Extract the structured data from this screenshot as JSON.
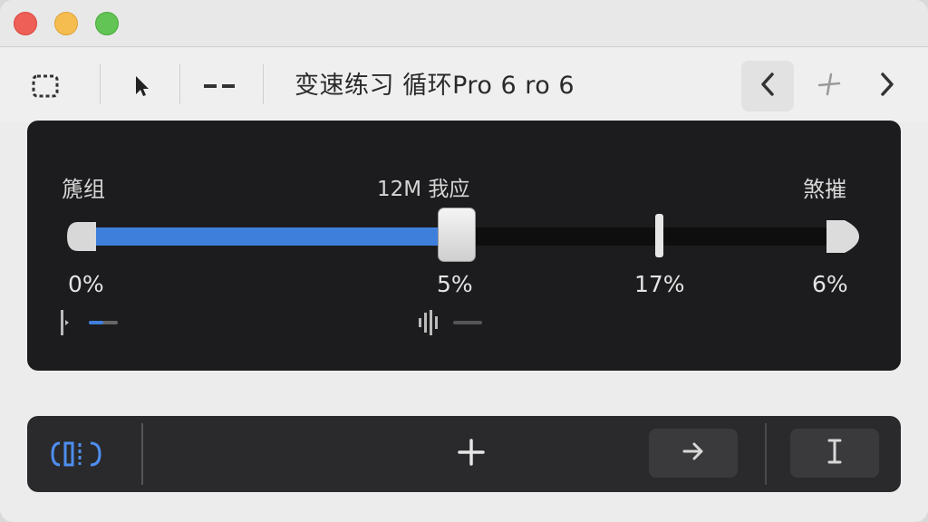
{
  "toolbar": {
    "title": "变速练习 循环Pro 6  ro 6",
    "icons": [
      "selection-marquee-icon",
      "pointer-arrow-icon",
      "dash-icon"
    ],
    "nav": [
      "chevron-left-icon",
      "pin-icon",
      "chevron-right-icon"
    ]
  },
  "slider": {
    "label_left": "篪组",
    "label_center": "12M  我应",
    "label_right": "煞摧",
    "value_left": "0%",
    "value_center": "5%",
    "value_marker": "17%",
    "value_right": "6%",
    "fill_fraction": 0.505,
    "marker_fraction": 0.77,
    "accent": "#3f7fdc"
  },
  "bottom": {
    "left_icon": "loop-bracket-icon",
    "center_icon": "plus-icon",
    "forward_icon": "arrow-right-icon",
    "text_icon": "text-cursor-icon",
    "accent": "#4f8ef0"
  }
}
